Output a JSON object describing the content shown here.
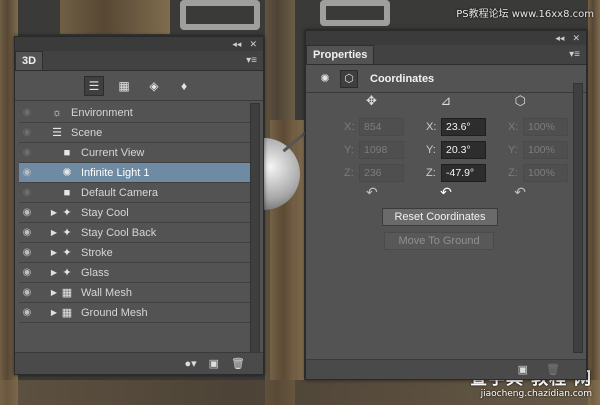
{
  "watermark": {
    "top": "PS教程论坛 www.16xx8.com",
    "bottom_big": "查字典 教程 网",
    "bottom_small": "jiaocheng.chazidian.com"
  },
  "panel3d": {
    "tab_label": "3D",
    "controls": {
      "collapse": "◂◂",
      "close": "✕",
      "menu": "▾≡"
    },
    "filter_buttons": [
      {
        "name": "whole-scene",
        "glyph": "☰",
        "active": true
      },
      {
        "name": "meshes",
        "glyph": "▦",
        "active": false
      },
      {
        "name": "materials",
        "glyph": "◈",
        "active": false
      },
      {
        "name": "lights",
        "glyph": "♦",
        "active": false
      }
    ],
    "layers": [
      {
        "label": "Environment",
        "icon": "☼",
        "expander": "",
        "eye_dim": true,
        "selected": false,
        "indent": 0
      },
      {
        "label": "Scene",
        "icon": "☰",
        "expander": "",
        "eye_dim": true,
        "selected": false,
        "indent": 0
      },
      {
        "label": "Current View",
        "icon": "■",
        "expander": "",
        "eye_dim": true,
        "selected": false,
        "indent": 1
      },
      {
        "label": "Infinite Light 1",
        "icon": "✺",
        "expander": "",
        "eye_dim": false,
        "selected": true,
        "indent": 1
      },
      {
        "label": "Default Camera",
        "icon": "■",
        "expander": "",
        "eye_dim": true,
        "selected": false,
        "indent": 1
      },
      {
        "label": "Stay  Cool",
        "icon": "✦",
        "expander": "▶",
        "eye_dim": false,
        "selected": false,
        "indent": 1
      },
      {
        "label": "Stay  Cool Back",
        "icon": "✦",
        "expander": "▶",
        "eye_dim": false,
        "selected": false,
        "indent": 1
      },
      {
        "label": "Stroke",
        "icon": "✦",
        "expander": "▶",
        "eye_dim": false,
        "selected": false,
        "indent": 1
      },
      {
        "label": "Glass",
        "icon": "✦",
        "expander": "▶",
        "eye_dim": false,
        "selected": false,
        "indent": 1
      },
      {
        "label": "Wall Mesh",
        "icon": "▦",
        "expander": "▶",
        "eye_dim": false,
        "selected": false,
        "indent": 1
      },
      {
        "label": "Ground Mesh",
        "icon": "▦",
        "expander": "▶",
        "eye_dim": false,
        "selected": false,
        "indent": 1
      }
    ],
    "footer": {
      "light": "●▾",
      "new": "▣",
      "delete": "🗑"
    }
  },
  "properties": {
    "tab_label": "Properties",
    "controls": {
      "collapse": "◂◂",
      "close": "✕",
      "menu": "▾≡"
    },
    "header_title": "Coordinates",
    "column_icons": [
      "✥",
      "⊿",
      "⬡"
    ],
    "rows": [
      {
        "pos_label": "X:",
        "pos": "854",
        "rot_label": "X:",
        "rot": "23.6°",
        "scale_label": "X:",
        "scale": "100%"
      },
      {
        "pos_label": "Y:",
        "pos": "1098",
        "rot_label": "Y:",
        "rot": "20.3°",
        "scale_label": "Y:",
        "scale": "100%"
      },
      {
        "pos_label": "Z:",
        "pos": "236",
        "rot_label": "Z:",
        "rot": "-47.9°",
        "scale_label": "Z:",
        "scale": "100%"
      }
    ],
    "reset_icons": [
      "↶",
      "↶",
      "↶"
    ],
    "reset_button": "Reset Coordinates",
    "ground_button": "Move To Ground",
    "footer": {
      "new": "▣",
      "delete": "🗑"
    }
  }
}
